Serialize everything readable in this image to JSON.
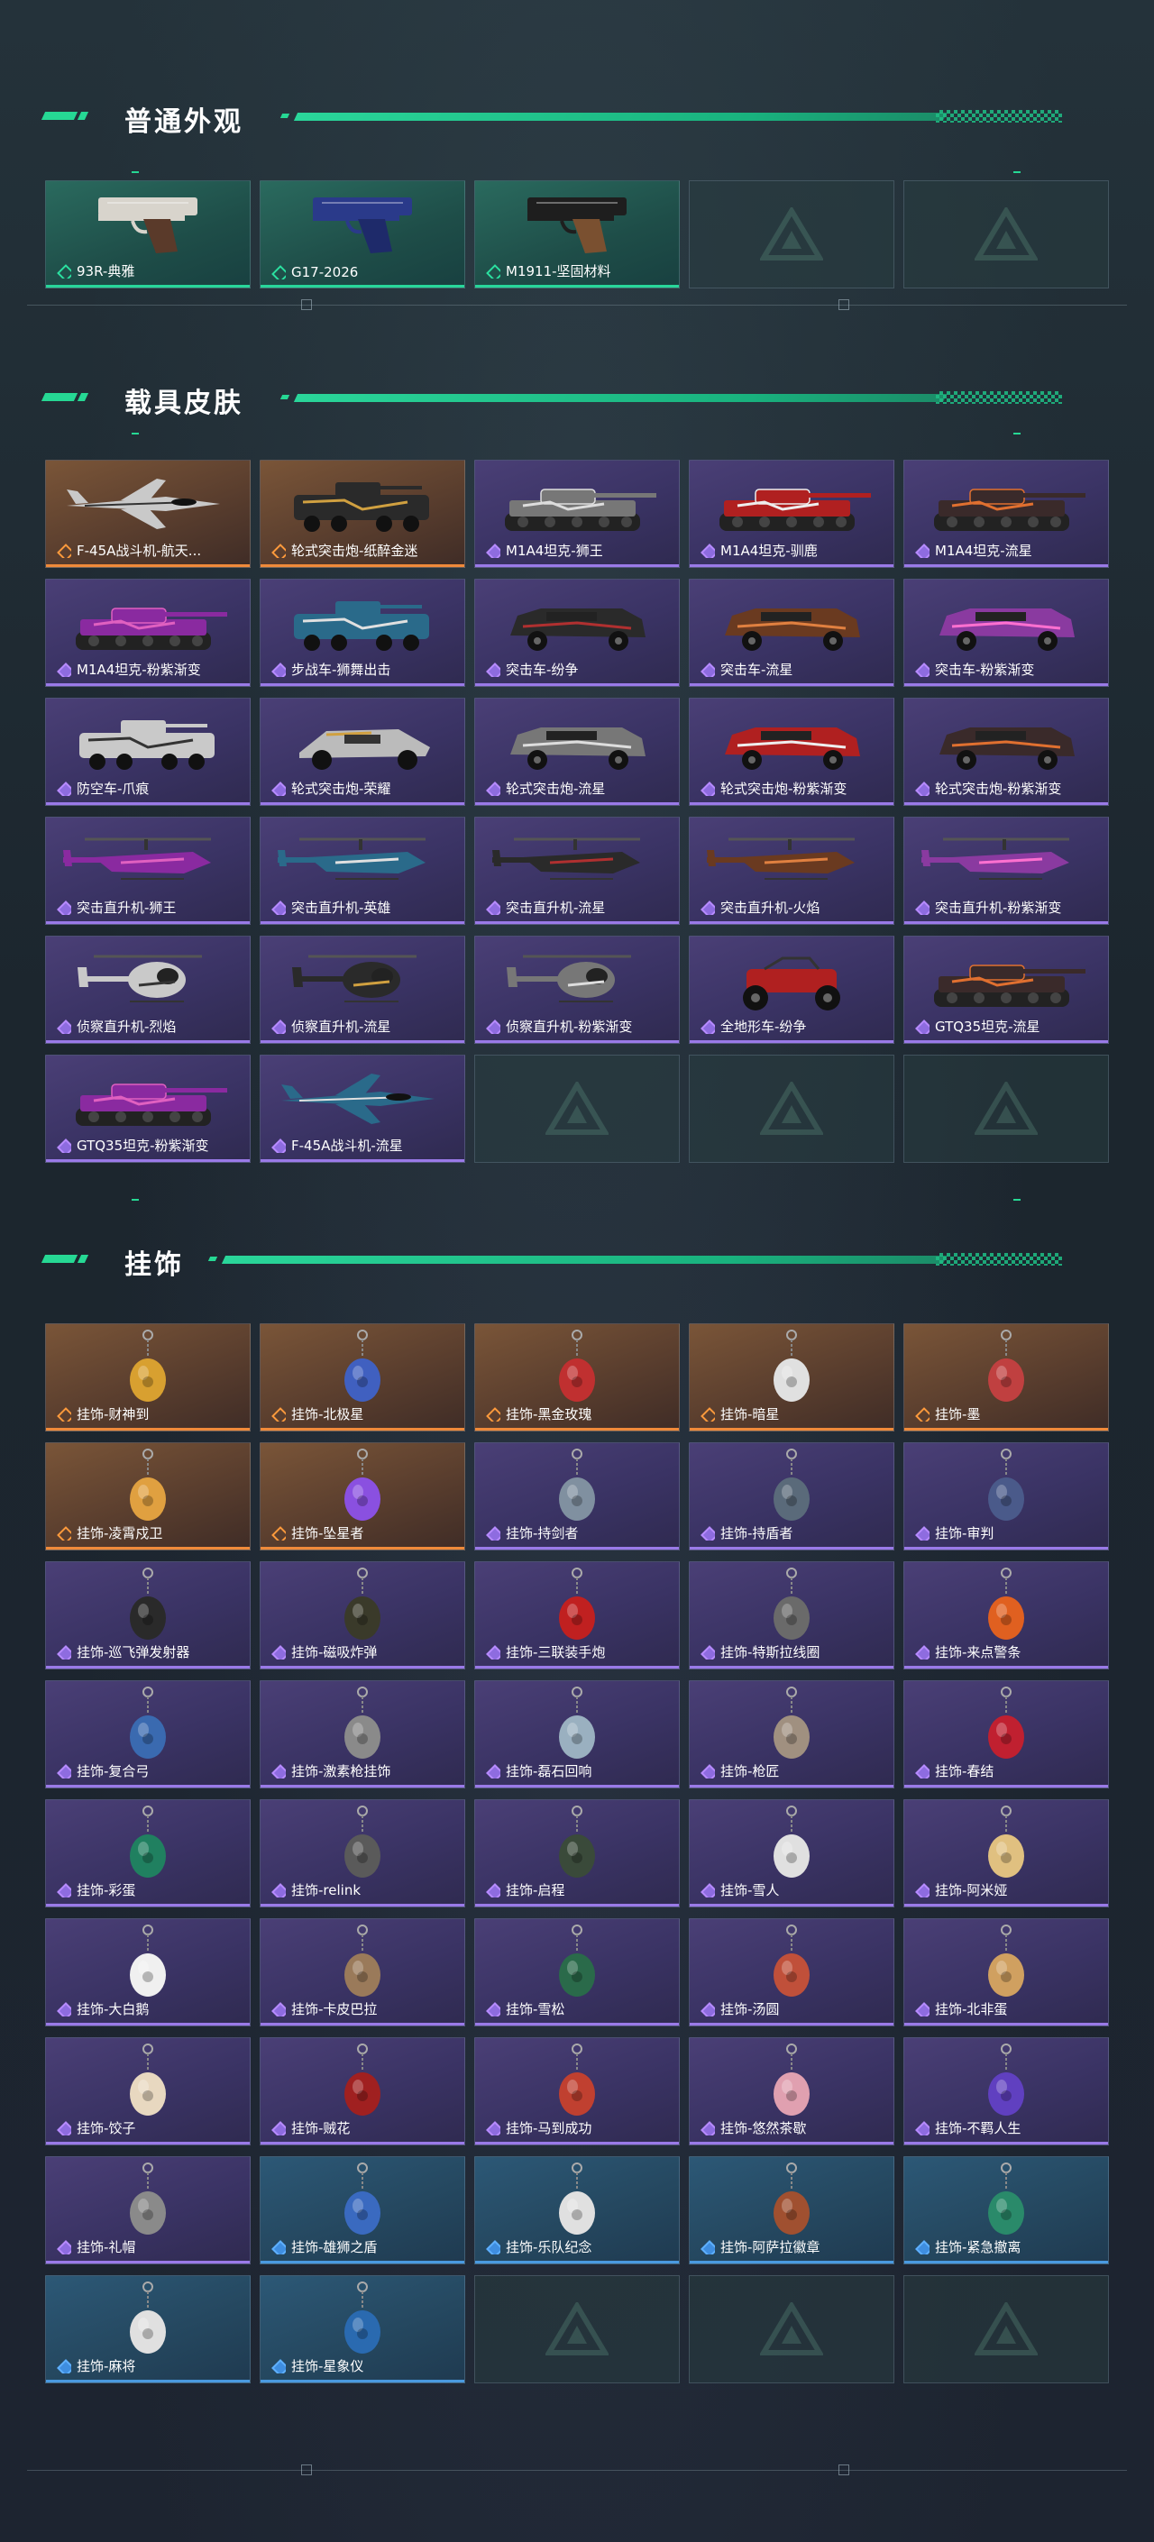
{
  "sections": {
    "appearance": {
      "title": "普通外观",
      "items": [
        {
          "name": "93R-典雅",
          "rarity": "green",
          "kind": "pistol-silver"
        },
        {
          "name": "G17-2026",
          "rarity": "green",
          "kind": "pistol-blue"
        },
        {
          "name": "M1911-坚固材料",
          "rarity": "green",
          "kind": "pistol-black"
        },
        {
          "name": "",
          "rarity": "empty"
        },
        {
          "name": "",
          "rarity": "empty"
        }
      ]
    },
    "vehicles": {
      "title": "载具皮肤",
      "items": [
        {
          "name": "F-45A战斗机-航天...",
          "rarity": "orange",
          "kind": "jet"
        },
        {
          "name": "轮式突击炮-纸醉金迷",
          "rarity": "orange",
          "kind": "apc"
        },
        {
          "name": "M1A4坦克-狮王",
          "rarity": "purple",
          "kind": "tank"
        },
        {
          "name": "M1A4坦克-驯鹿",
          "rarity": "purple",
          "kind": "tank"
        },
        {
          "name": "M1A4坦克-流星",
          "rarity": "purple",
          "kind": "tank"
        },
        {
          "name": "M1A4坦克-粉紫渐变",
          "rarity": "purple",
          "kind": "tank"
        },
        {
          "name": "步战车-狮舞出击",
          "rarity": "purple",
          "kind": "apc"
        },
        {
          "name": "突击车-纷争",
          "rarity": "purple",
          "kind": "truck"
        },
        {
          "name": "突击车-流星",
          "rarity": "purple",
          "kind": "truck"
        },
        {
          "name": "突击车-粉紫渐变",
          "rarity": "purple",
          "kind": "truck"
        },
        {
          "name": "防空车-爪痕",
          "rarity": "purple",
          "kind": "apc"
        },
        {
          "name": "轮式突击炮-荣耀",
          "rarity": "purple",
          "kind": "buggy"
        },
        {
          "name": "轮式突击炮-流星",
          "rarity": "purple",
          "kind": "truck"
        },
        {
          "name": "轮式突击炮-粉紫渐变",
          "rarity": "purple",
          "kind": "truck"
        },
        {
          "name": "轮式突击炮-粉紫渐变",
          "rarity": "purple",
          "kind": "truck"
        },
        {
          "name": "突击直升机-狮王",
          "rarity": "purple",
          "kind": "heli"
        },
        {
          "name": "突击直升机-英雄",
          "rarity": "purple",
          "kind": "heli"
        },
        {
          "name": "突击直升机-流星",
          "rarity": "purple",
          "kind": "heli"
        },
        {
          "name": "突击直升机-火焰",
          "rarity": "purple",
          "kind": "heli"
        },
        {
          "name": "突击直升机-粉紫渐变",
          "rarity": "purple",
          "kind": "heli"
        },
        {
          "name": "侦察直升机-烈焰",
          "rarity": "purple",
          "kind": "littlebird"
        },
        {
          "name": "侦察直升机-流星",
          "rarity": "purple",
          "kind": "littlebird"
        },
        {
          "name": "侦察直升机-粉紫渐变",
          "rarity": "purple",
          "kind": "littlebird"
        },
        {
          "name": "全地形车-纷争",
          "rarity": "purple",
          "kind": "atv"
        },
        {
          "name": "GTQ35坦克-流星",
          "rarity": "purple",
          "kind": "tank"
        },
        {
          "name": "GTQ35坦克-粉紫渐变",
          "rarity": "purple",
          "kind": "tank"
        },
        {
          "name": "F-45A战斗机-流星",
          "rarity": "purple",
          "kind": "jet"
        },
        {
          "name": "",
          "rarity": "empty"
        },
        {
          "name": "",
          "rarity": "empty"
        },
        {
          "name": "",
          "rarity": "empty"
        }
      ]
    },
    "charms": {
      "title": "挂饰",
      "items": [
        {
          "name": "挂饰-财神到",
          "rarity": "orange"
        },
        {
          "name": "挂饰-北极星",
          "rarity": "orange"
        },
        {
          "name": "挂饰-黑金玫瑰",
          "rarity": "orange"
        },
        {
          "name": "挂饰-暗星",
          "rarity": "orange"
        },
        {
          "name": "挂饰-墨",
          "rarity": "orange"
        },
        {
          "name": "挂饰-凌霄戍卫",
          "rarity": "orange"
        },
        {
          "name": "挂饰-坠星者",
          "rarity": "orange"
        },
        {
          "name": "挂饰-持剑者",
          "rarity": "purple"
        },
        {
          "name": "挂饰-持盾者",
          "rarity": "purple"
        },
        {
          "name": "挂饰-审判",
          "rarity": "purple"
        },
        {
          "name": "挂饰-巡飞弹发射器",
          "rarity": "purple"
        },
        {
          "name": "挂饰-磁吸炸弹",
          "rarity": "purple"
        },
        {
          "name": "挂饰-三联装手炮",
          "rarity": "purple"
        },
        {
          "name": "挂饰-特斯拉线圈",
          "rarity": "purple"
        },
        {
          "name": "挂饰-来点警条",
          "rarity": "purple"
        },
        {
          "name": "挂饰-复合弓",
          "rarity": "purple"
        },
        {
          "name": "挂饰-激素枪挂饰",
          "rarity": "purple"
        },
        {
          "name": "挂饰-磊石回响",
          "rarity": "purple"
        },
        {
          "name": "挂饰-枪匠",
          "rarity": "purple"
        },
        {
          "name": "挂饰-春结",
          "rarity": "purple"
        },
        {
          "name": "挂饰-彩蛋",
          "rarity": "purple"
        },
        {
          "name": "挂饰-relink",
          "rarity": "purple"
        },
        {
          "name": "挂饰-启程",
          "rarity": "purple"
        },
        {
          "name": "挂饰-雪人",
          "rarity": "purple"
        },
        {
          "name": "挂饰-阿米娅",
          "rarity": "purple"
        },
        {
          "name": "挂饰-大白鹅",
          "rarity": "purple"
        },
        {
          "name": "挂饰-卡皮巴拉",
          "rarity": "purple"
        },
        {
          "name": "挂饰-雪松",
          "rarity": "purple"
        },
        {
          "name": "挂饰-汤圆",
          "rarity": "purple"
        },
        {
          "name": "挂饰-北非蛋",
          "rarity": "purple"
        },
        {
          "name": "挂饰-饺子",
          "rarity": "purple"
        },
        {
          "name": "挂饰-贼花",
          "rarity": "purple"
        },
        {
          "name": "挂饰-马到成功",
          "rarity": "purple"
        },
        {
          "name": "挂饰-悠然茶歇",
          "rarity": "purple"
        },
        {
          "name": "挂饰-不羁人生",
          "rarity": "purple"
        },
        {
          "name": "挂饰-礼帽",
          "rarity": "purple"
        },
        {
          "name": "挂饰-雄狮之盾",
          "rarity": "blue"
        },
        {
          "name": "挂饰-乐队纪念",
          "rarity": "blue"
        },
        {
          "name": "挂饰-阿萨拉徽章",
          "rarity": "blue"
        },
        {
          "name": "挂饰-紧急撤离",
          "rarity": "blue"
        },
        {
          "name": "挂饰-麻将",
          "rarity": "blue"
        },
        {
          "name": "挂饰-星象仪",
          "rarity": "blue"
        },
        {
          "name": "",
          "rarity": "empty"
        },
        {
          "name": "",
          "rarity": "empty"
        },
        {
          "name": "",
          "rarity": "empty"
        }
      ]
    }
  },
  "colors": {
    "accent": "#26d894",
    "orange": "#f08a3a",
    "purple": "#9a7ae8",
    "blue": "#4a9ae0"
  }
}
